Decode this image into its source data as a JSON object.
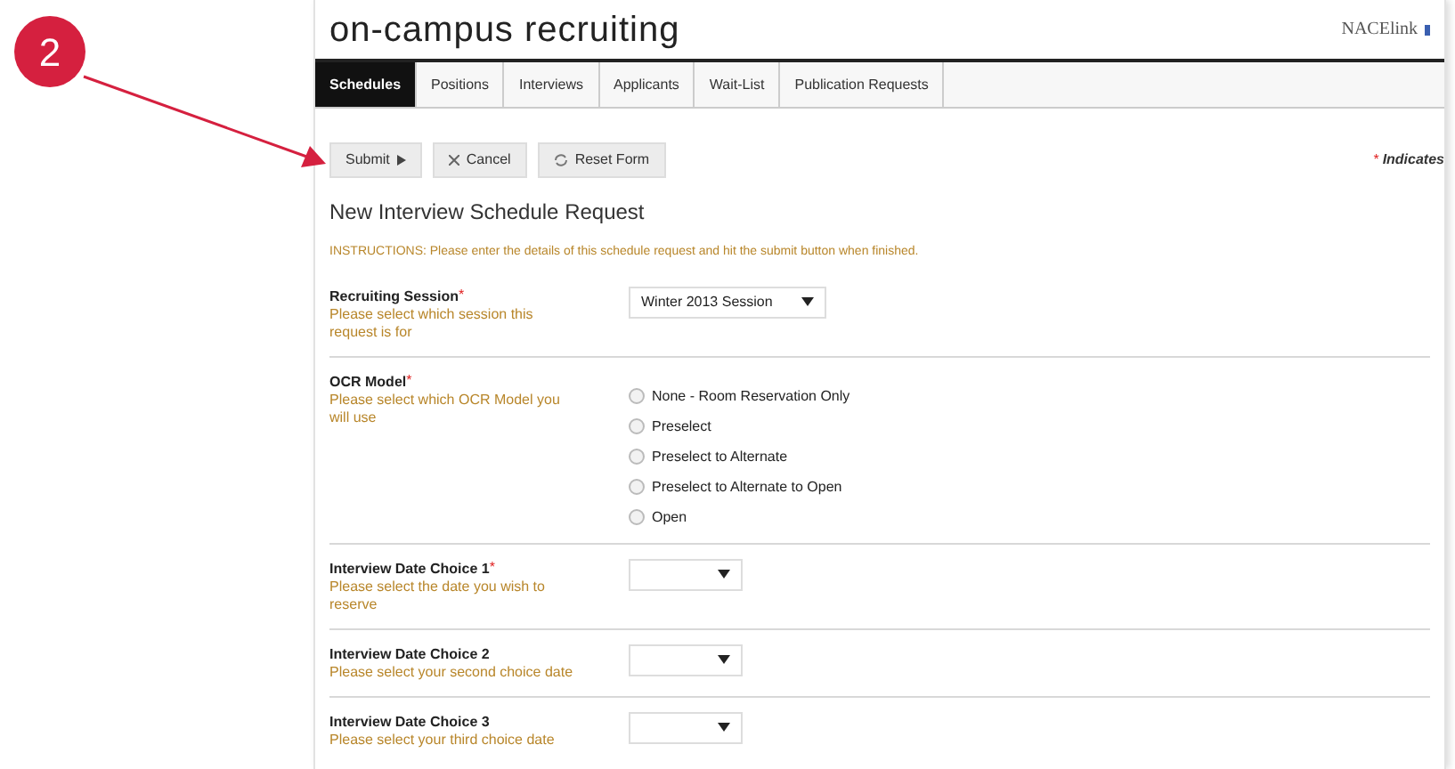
{
  "step_marker": {
    "label": "2"
  },
  "header": {
    "title": "on-campus recruiting",
    "logo": "NACElink"
  },
  "tabs": [
    {
      "label": "Schedules",
      "selected": true
    },
    {
      "label": "Positions",
      "selected": false
    },
    {
      "label": "Interviews",
      "selected": false
    },
    {
      "label": "Applicants",
      "selected": false
    },
    {
      "label": "Wait-List",
      "selected": false
    },
    {
      "label": "Publication Requests",
      "selected": false
    }
  ],
  "toolbar": [
    {
      "label": "Submit",
      "kind": "submit"
    },
    {
      "label": "Cancel",
      "kind": "cancel"
    },
    {
      "label": "Reset Form",
      "kind": "reset"
    }
  ],
  "required_note": {
    "mark": "*",
    "text": "Indicates"
  },
  "form": {
    "title": "New Interview Schedule Request",
    "instructions": "INSTRUCTIONS: Please enter the details of this schedule request and hit the submit button when finished.",
    "fields": [
      {
        "kind": "select",
        "label": "Recruiting Session",
        "required": true,
        "hint": "Please select which session this request is for",
        "value": "Winter 2013 Session"
      },
      {
        "kind": "radio",
        "label": "OCR Model",
        "required": true,
        "hint": "Please select which OCR Model you will use",
        "options": [
          {
            "label": "None - Room Reservation Only",
            "selected": false
          },
          {
            "label": "Preselect",
            "selected": false
          },
          {
            "label": "Preselect to Alternate",
            "selected": false
          },
          {
            "label": "Preselect to Alternate to Open",
            "selected": false
          },
          {
            "label": "Open",
            "selected": false
          }
        ]
      },
      {
        "kind": "select",
        "label": "Interview Date Choice 1",
        "required": true,
        "hint": "Please select the date you wish to reserve"
      },
      {
        "kind": "select",
        "label": "Interview Date Choice 2",
        "required": false,
        "hint": "Please select your second choice date"
      },
      {
        "kind": "select",
        "label": "Interview Date Choice 3",
        "required": false,
        "hint": "Please select your third choice date"
      }
    ]
  }
}
